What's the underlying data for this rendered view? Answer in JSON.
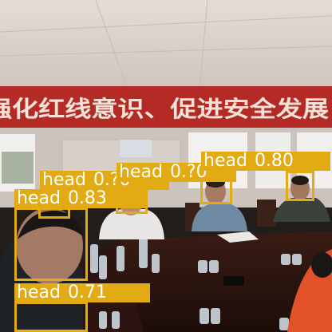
{
  "image": {
    "banner_text": "强化红线意识、促进安全发展",
    "wall_color": "#d8cec5",
    "banner_color": "#b42a25",
    "box_color": "#e2ab14",
    "label_text_color": "#ffffff"
  },
  "detections": [
    {
      "label": "head",
      "score": "0.83"
    },
    {
      "label": "head",
      "score": "0.?0"
    },
    {
      "label": "head",
      "score": "0.?0"
    },
    {
      "label": "head",
      "score": "0.80"
    },
    {
      "label": "head",
      "score": ""
    },
    {
      "label": "head",
      "score": "0.71"
    }
  ]
}
